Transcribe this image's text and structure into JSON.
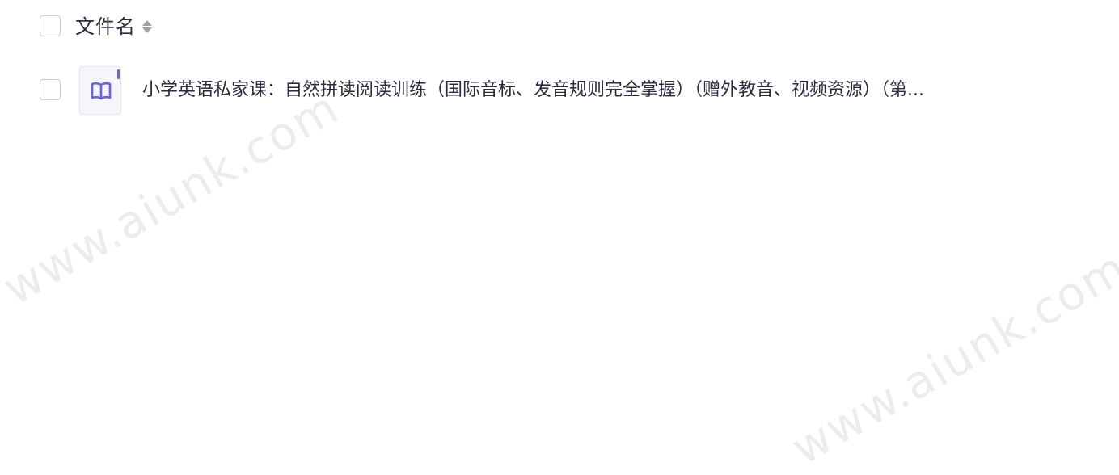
{
  "table": {
    "header": {
      "column_name": "文件名",
      "sort_icon": "sort-icon"
    },
    "rows": [
      {
        "file_name": "小学英语私家课：自然拼读阅读训练（国际音标、发音规则完全掌握）（赠外教音、视频资源）（第...",
        "file_icon": "book-icon"
      }
    ]
  },
  "watermark": {
    "text": "www.aiunk.com"
  },
  "colors": {
    "accent": "#6b63d8",
    "text": "#2a2b3d",
    "checkbox_border": "#c9cbd3"
  }
}
